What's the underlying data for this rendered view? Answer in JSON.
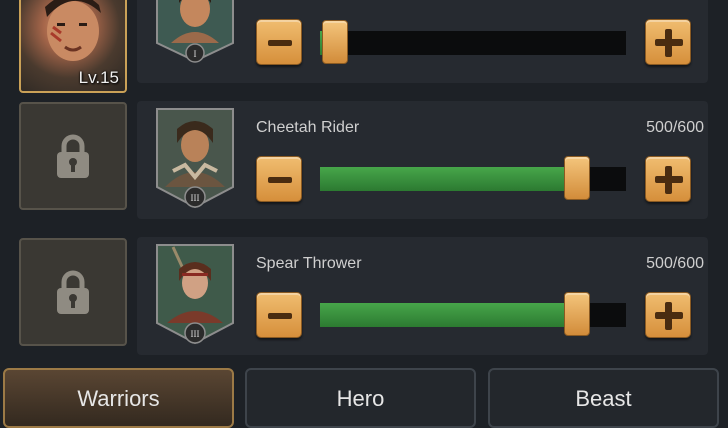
{
  "rows": [
    {
      "level_label": "Lv.15",
      "unit_name": "",
      "count": "",
      "rank": "I",
      "progress": 0.05
    },
    {
      "unit_name": "Cheetah Rider",
      "count": "500/600",
      "rank": "III",
      "progress": 0.84
    },
    {
      "unit_name": "Spear Thrower",
      "count": "500/600",
      "rank": "III",
      "progress": 0.84
    }
  ],
  "tabs": [
    {
      "label": "Warriors",
      "active": true
    },
    {
      "label": "Hero",
      "active": false
    },
    {
      "label": "Beast",
      "active": false
    }
  ],
  "colors": {
    "accent": "#e0a352",
    "bar_fill": "#3f9a44",
    "track": "#0b0c0d",
    "panel": "#262a30"
  },
  "icons": [
    "lock-icon",
    "minus-icon",
    "plus-icon",
    "rank-badge-icon"
  ]
}
